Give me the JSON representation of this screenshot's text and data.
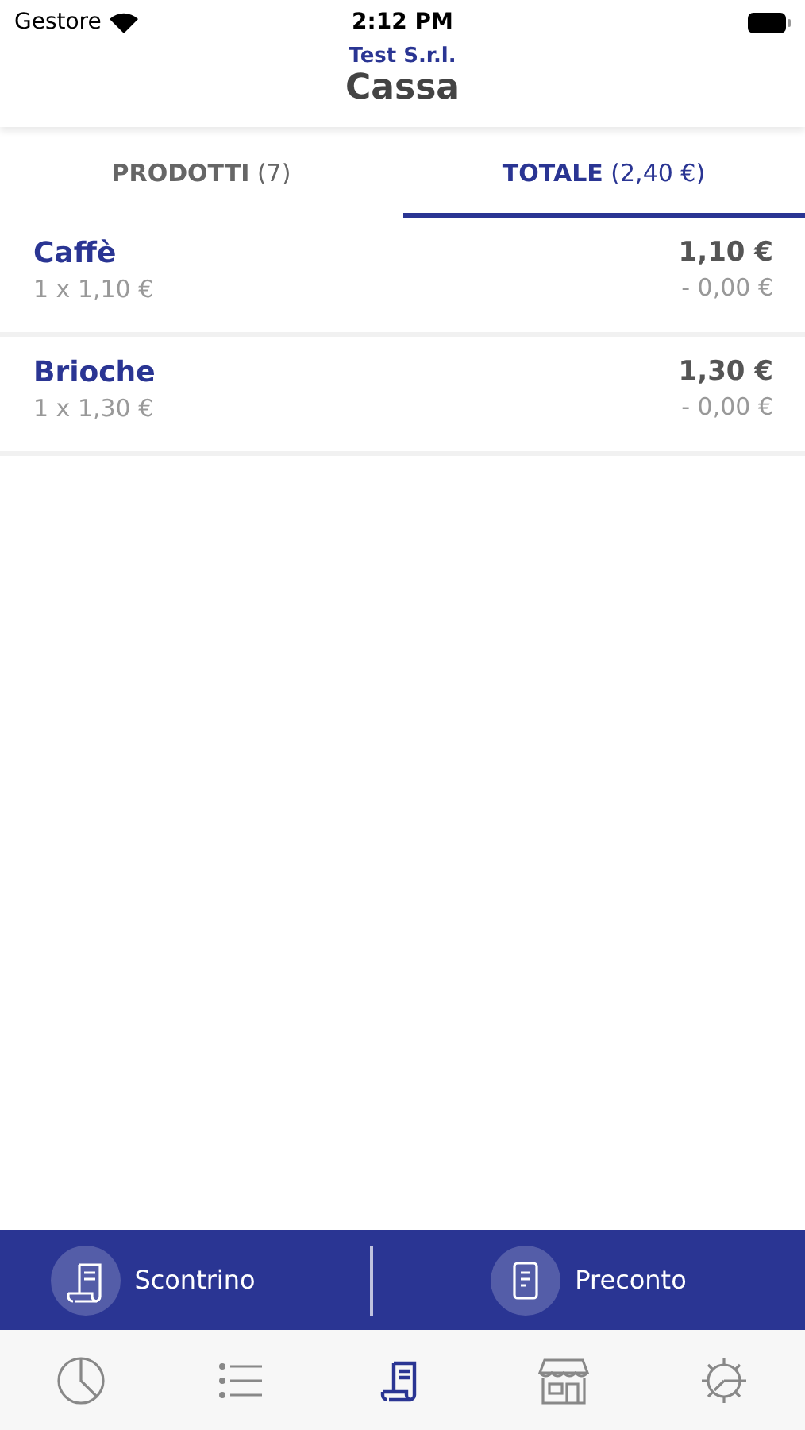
{
  "status_bar": {
    "carrier": "Gestore",
    "time": "2:12 PM"
  },
  "header": {
    "subtitle": "Test S.r.l.",
    "title": "Cassa"
  },
  "tabs": [
    {
      "label": "**PRODOTTI** (7)",
      "selected": false
    },
    {
      "label": "**TOTALE** (2,40 €)",
      "selected": true
    }
  ],
  "items": [
    {
      "name": "Caffè",
      "detail": "1 x 1,10 €",
      "price": "1,10 €",
      "discount": "- 0,00 €"
    },
    {
      "name": "Brioche",
      "detail": "1 x 1,30 €",
      "price": "1,30 €",
      "discount": "- 0,00 €"
    }
  ],
  "actions": [
    {
      "kind": "receipt",
      "label": "Scontrino"
    },
    {
      "kind": "document",
      "label": "Preconto"
    }
  ],
  "tab_bar": [
    {
      "kind": "chart",
      "selected": false
    },
    {
      "kind": "list",
      "selected": false
    },
    {
      "kind": "receipt",
      "selected": true
    },
    {
      "kind": "store",
      "selected": false
    },
    {
      "kind": "settings",
      "selected": false
    }
  ]
}
